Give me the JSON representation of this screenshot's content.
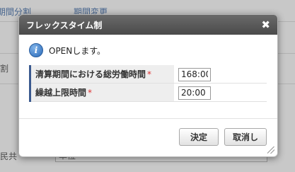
{
  "background": {
    "tab1": "期間分割",
    "tab2": "期間変更",
    "side_label": "割",
    "bottom_label": "民共",
    "bottom_value": "単位"
  },
  "dialog": {
    "title": "フレックスタイム制",
    "close_symbol": "✖",
    "message": "OPENします。",
    "fields": [
      {
        "label": "清算期間における総労働時間",
        "required_mark": "*",
        "value": "168:00"
      },
      {
        "label": "繰越上限時間",
        "required_mark": "*",
        "value": "20:00"
      }
    ],
    "ok_label": "決定",
    "cancel_label": "取消し"
  }
}
